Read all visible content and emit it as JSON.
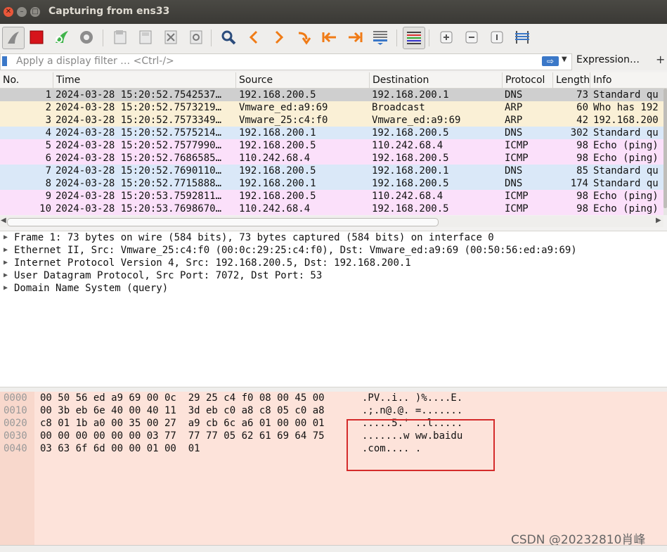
{
  "window": {
    "title": "Capturing from ens33"
  },
  "filter": {
    "placeholder": "Apply a display filter … <Ctrl-/>",
    "expression_label": "Expression…",
    "plus_label": "+"
  },
  "colors": {
    "dns_row": "#dae8f8",
    "arp_row": "#faf0d6",
    "icmp_row": "#fbe0fa",
    "selected_row": "#cfcfcf",
    "bytes_bg": "#fde3da",
    "highlight_box": "#d42b2b"
  },
  "columns": [
    "No.",
    "Time",
    "Source",
    "Destination",
    "Protocol",
    "Length",
    "Info"
  ],
  "packets": [
    {
      "no": "1",
      "time": "2024-03-28 15:20:52.7542537…",
      "source": "192.168.200.5",
      "destination": "192.168.200.1",
      "protocol": "DNS",
      "length": "73",
      "info": "Standard qu",
      "kind": "selected"
    },
    {
      "no": "2",
      "time": "2024-03-28 15:20:52.7573219…",
      "source": "Vmware_ed:a9:69",
      "destination": "Broadcast",
      "protocol": "ARP",
      "length": "60",
      "info": "Who has 192",
      "kind": "arp"
    },
    {
      "no": "3",
      "time": "2024-03-28 15:20:52.7573349…",
      "source": "Vmware_25:c4:f0",
      "destination": "Vmware_ed:a9:69",
      "protocol": "ARP",
      "length": "42",
      "info": "192.168.200",
      "kind": "arp"
    },
    {
      "no": "4",
      "time": "2024-03-28 15:20:52.7575214…",
      "source": "192.168.200.1",
      "destination": "192.168.200.5",
      "protocol": "DNS",
      "length": "302",
      "info": "Standard qu",
      "kind": "dns"
    },
    {
      "no": "5",
      "time": "2024-03-28 15:20:52.7577990…",
      "source": "192.168.200.5",
      "destination": "110.242.68.4",
      "protocol": "ICMP",
      "length": "98",
      "info": "Echo (ping)",
      "kind": "icmp"
    },
    {
      "no": "6",
      "time": "2024-03-28 15:20:52.7686585…",
      "source": "110.242.68.4",
      "destination": "192.168.200.5",
      "protocol": "ICMP",
      "length": "98",
      "info": "Echo (ping)",
      "kind": "icmp"
    },
    {
      "no": "7",
      "time": "2024-03-28 15:20:52.7690110…",
      "source": "192.168.200.5",
      "destination": "192.168.200.1",
      "protocol": "DNS",
      "length": "85",
      "info": "Standard qu",
      "kind": "dns"
    },
    {
      "no": "8",
      "time": "2024-03-28 15:20:52.7715888…",
      "source": "192.168.200.1",
      "destination": "192.168.200.5",
      "protocol": "DNS",
      "length": "174",
      "info": "Standard qu",
      "kind": "dns"
    },
    {
      "no": "9",
      "time": "2024-03-28 15:20:53.7592811…",
      "source": "192.168.200.5",
      "destination": "110.242.68.4",
      "protocol": "ICMP",
      "length": "98",
      "info": "Echo (ping)",
      "kind": "icmp"
    },
    {
      "no": "10",
      "time": "2024-03-28 15:20:53.7698670…",
      "source": "110.242.68.4",
      "destination": "192.168.200.5",
      "protocol": "ICMP",
      "length": "98",
      "info": "Echo (ping)",
      "kind": "icmp"
    }
  ],
  "details": [
    "Frame 1: 73 bytes on wire (584 bits), 73 bytes captured (584 bits) on interface 0",
    "Ethernet II, Src: Vmware_25:c4:f0 (00:0c:29:25:c4:f0), Dst: Vmware_ed:a9:69 (00:50:56:ed:a9:69)",
    "Internet Protocol Version 4, Src: 192.168.200.5, Dst: 192.168.200.1",
    "User Datagram Protocol, Src Port: 7072, Dst Port: 53",
    "Domain Name System (query)"
  ],
  "bytes": [
    {
      "offset": "0000",
      "hex": "00 50 56 ed a9 69 00 0c  29 25 c4 f0 08 00 45 00",
      "ascii": ".PV..i.. )%....E."
    },
    {
      "offset": "0010",
      "hex": "00 3b eb 6e 40 00 40 11  3d eb c0 a8 c8 05 c0 a8",
      "ascii": ".;.n@.@. =......."
    },
    {
      "offset": "0020",
      "hex": "c8 01 1b a0 00 35 00 27  a9 cb 6c a6 01 00 00 01",
      "ascii": ".....5.' ..l....."
    },
    {
      "offset": "0030",
      "hex": "00 00 00 00 00 00 03 77  77 77 05 62 61 69 64 75",
      "ascii": ".......w ww.baidu"
    },
    {
      "offset": "0040",
      "hex": "03 63 6f 6d 00 00 01 00  01",
      "ascii": ".com.... ."
    }
  ],
  "watermark": "CSDN @20232810肖峰"
}
